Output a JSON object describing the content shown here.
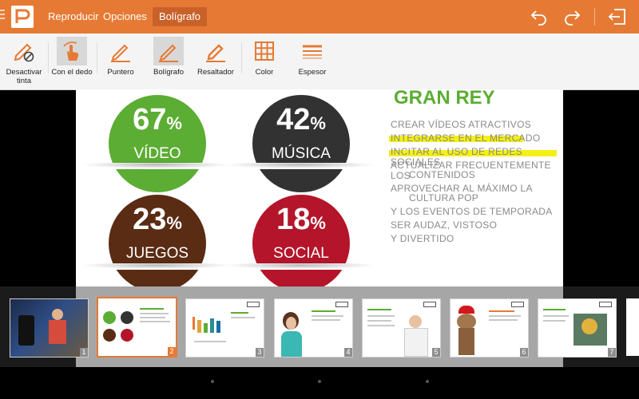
{
  "colors": {
    "accent": "#e67a34",
    "green": "#5cad33",
    "dark": "#323232",
    "brown": "#5a2c14",
    "red": "#b4152a",
    "highlight": "#f4f017"
  },
  "app": {
    "logo_icon": "presentation-p-icon"
  },
  "tabs": [
    {
      "label": "Reproducir",
      "active": false
    },
    {
      "label": "Opciones",
      "active": false
    },
    {
      "label": "Bolígrafo",
      "active": true
    }
  ],
  "topbar_right": [
    {
      "icon": "undo-icon"
    },
    {
      "icon": "redo-icon"
    },
    {
      "icon": "exit-icon"
    }
  ],
  "tools": [
    {
      "label": "Desactivar\ntinta",
      "icon": "pen-disable-icon",
      "selected": false
    },
    {
      "label": "Con el dedo",
      "icon": "finger-touch-icon",
      "selected": true
    },
    {
      "label": "Puntero",
      "icon": "pointer-pen-icon",
      "selected": false
    },
    {
      "label": "Bolígrafo",
      "icon": "pen-icon",
      "selected": true
    },
    {
      "label": "Resaltador",
      "icon": "highlighter-icon",
      "selected": false
    },
    {
      "label": "Color",
      "icon": "color-grid-icon",
      "selected": false
    },
    {
      "label": "Espesor",
      "icon": "thickness-icon",
      "selected": false
    }
  ],
  "slide": {
    "title": "GRAN REY",
    "stats": [
      {
        "value": "67",
        "unit": "%",
        "label": "VÍDEO",
        "color": "green"
      },
      {
        "value": "42",
        "unit": "%",
        "label": "MÚSICA",
        "color": "dark"
      },
      {
        "value": "23",
        "unit": "%",
        "label": "JUEGOS",
        "color": "brown"
      },
      {
        "value": "18",
        "unit": "%",
        "label": "SOCIAL",
        "color": "red"
      }
    ],
    "bullets": [
      {
        "line1": "CREAR VÍDEOS ATRACTIVOS",
        "line2": "",
        "highlighted": false
      },
      {
        "line1": "INTEGRARSE EN EL MERCADO",
        "line2": "",
        "highlighted": true
      },
      {
        "line1": "INCITAR AL USO DE REDES SOCIALES",
        "line2": "",
        "highlighted": true
      },
      {
        "line1": "ACTUALIZAR FRECUENTEMENTE LOS",
        "line2": "CONTENIDOS",
        "highlighted": false
      },
      {
        "line1": "APROVECHAR AL MÁXIMO LA",
        "line2": "CULTURA POP",
        "highlighted": false
      },
      {
        "line1": "Y LOS EVENTOS DE TEMPORADA",
        "line2": "",
        "highlighted": false
      },
      {
        "line1": "SER AUDAZ, VISTOSO",
        "line2": "",
        "highlighted": false
      },
      {
        "line1": "Y DIVERTIDO",
        "line2": "",
        "highlighted": false
      }
    ]
  },
  "thumbnails": [
    {
      "number": "1",
      "selected": false
    },
    {
      "number": "2",
      "selected": true
    },
    {
      "number": "3",
      "selected": false
    },
    {
      "number": "4",
      "selected": false
    },
    {
      "number": "5",
      "selected": false
    },
    {
      "number": "6",
      "selected": false
    },
    {
      "number": "7",
      "selected": false
    }
  ]
}
